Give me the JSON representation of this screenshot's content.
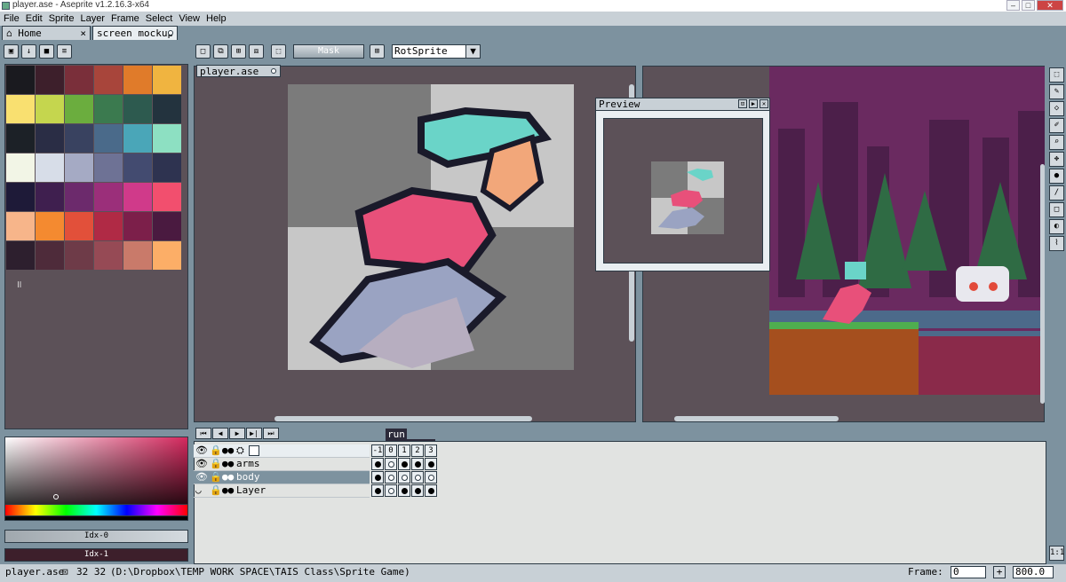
{
  "window": {
    "title": "player.ase - Aseprite v1.2.16.3-x64",
    "min": "–",
    "max": "□",
    "close": "✕"
  },
  "menu": [
    "File",
    "Edit",
    "Sprite",
    "Layer",
    "Frame",
    "Select",
    "View",
    "Help"
  ],
  "tabs": [
    {
      "label": "Home",
      "close": "×"
    },
    {
      "label": "screen mockup",
      "active": true
    }
  ],
  "toolbar": {
    "buttons": [
      "▣",
      "↓",
      "■",
      "≡"
    ],
    "selection_buttons": [
      "□",
      "⧉",
      "⊞",
      "⧈"
    ],
    "mask_label": "Mask",
    "rotation_algorithm": "RotSprite"
  },
  "document": {
    "tab_label": "player.ase"
  },
  "preview": {
    "title": "Preview"
  },
  "palette": {
    "colors": [
      "#1a1a1f",
      "#3d1f2b",
      "#7a2f3a",
      "#a8453b",
      "#e07b2a",
      "#f0b440",
      "#f9e070",
      "#c5d64e",
      "#6bad3e",
      "#3b7a4f",
      "#2d5a4f",
      "#23333e",
      "#1c2127",
      "#2a2d45",
      "#394260",
      "#4a6a8a",
      "#4aa6b8",
      "#8de0c2",
      "#f2f5e6",
      "#d7dde8",
      "#a5aac4",
      "#6e7295",
      "#434b70",
      "#2e3350",
      "#1e1a38",
      "#3f1f4f",
      "#6c2a6c",
      "#9b2f7a",
      "#d03a8a",
      "#f24f6e",
      "#f7b58a",
      "#f48a30",
      "#e2503a",
      "#b02a45",
      "#7c1f4a",
      "#4a1a40",
      "#2d1f2e",
      "#4e2b3a",
      "#6e3b48",
      "#964a55",
      "#c97a6a",
      "#fcae67"
    ],
    "marker": "॥"
  },
  "color": {
    "index1": "Idx-0",
    "index2": "Idx-1"
  },
  "timeline": {
    "controls": [
      "⏮",
      "◀",
      "▶",
      "▶|",
      "⏭"
    ],
    "tag": "run",
    "frames": [
      "-1",
      "0",
      "1",
      "2",
      "3"
    ],
    "layers": [
      {
        "name": "",
        "selected": false
      },
      {
        "name": "arms",
        "selected": false
      },
      {
        "name": "body",
        "selected": true
      },
      {
        "name": "Layer",
        "selected": false
      }
    ]
  },
  "statusbar": {
    "filename": "player.ase",
    "size": "32 32",
    "path": "(D:\\Dropbox\\TEMP WORK SPACE\\TAIS Class\\Sprite Game)",
    "frame_label": "Frame:",
    "frame_value": "0",
    "plus": "+",
    "zoom": "800.0"
  },
  "right_tools": [
    "⬚",
    "✎",
    "◇",
    "✐",
    "⌕",
    "✥",
    "●",
    "/",
    "□",
    "◐",
    "⌇"
  ],
  "right_tools_bottom": "1:1"
}
